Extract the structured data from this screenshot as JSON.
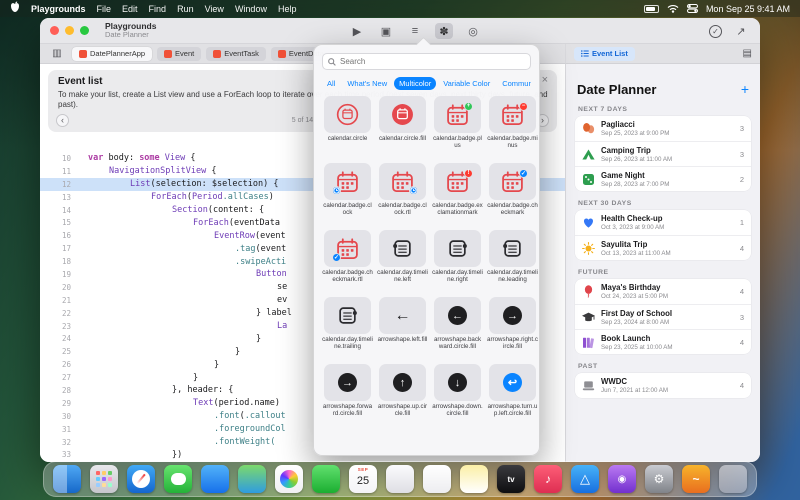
{
  "colors": {
    "accent": "#0A84FF",
    "symbol_red": "#E5484D",
    "selection": "#CDE1F9"
  },
  "menubar": {
    "app_name": "Playgrounds",
    "items": [
      "File",
      "Edit",
      "Find",
      "Run",
      "View",
      "Window",
      "Help"
    ],
    "clock": "Mon Sep 25 9:41 AM"
  },
  "titlebar": {
    "title": "Playgrounds",
    "subtitle": "Date Planner"
  },
  "toolbar": {
    "center": [
      {
        "name": "run",
        "glyph": "▶"
      },
      {
        "name": "live-preview",
        "glyph": "▣"
      },
      {
        "name": "inspector",
        "glyph": "≡"
      },
      {
        "name": "symbols-library",
        "glyph": "✽",
        "active": true
      },
      {
        "name": "device-settings",
        "glyph": "◎"
      }
    ],
    "right": [
      {
        "name": "status-done",
        "glyph": "✓",
        "circled": true
      },
      {
        "name": "enter-fullscreen",
        "glyph": "↗"
      }
    ]
  },
  "tabs": [
    {
      "label": "DatePlannerApp"
    },
    {
      "label": "Event"
    },
    {
      "label": "EventTask"
    },
    {
      "label": "EventData"
    }
  ],
  "lesson": {
    "title": "Event list",
    "body": "To make your list, create a List view and use a ForEach loop to iterate over each time period (next seven days, next thirty days, future, and past).",
    "page": "5 of 14"
  },
  "code": {
    "lines": [
      {
        "n": 10,
        "i": 0,
        "hl": false,
        "t": [
          [
            "var",
            "kw"
          ],
          [
            " body: ",
            "pl"
          ],
          [
            "some",
            "kw"
          ],
          [
            " ",
            "pl"
          ],
          [
            "View",
            "ty"
          ],
          [
            " {",
            "pl"
          ]
        ]
      },
      {
        "n": 11,
        "i": 1,
        "hl": false,
        "t": [
          [
            "NavigationSplitView",
            "ty"
          ],
          [
            " {",
            "pl"
          ]
        ]
      },
      {
        "n": 12,
        "i": 2,
        "hl": true,
        "t": [
          [
            "List",
            "ty"
          ],
          [
            "(selection: ",
            "pl"
          ],
          [
            "$selection",
            "pl"
          ],
          [
            ") {",
            "pl"
          ]
        ]
      },
      {
        "n": 13,
        "i": 3,
        "hl": false,
        "t": [
          [
            "ForEach",
            "ty"
          ],
          [
            "(",
            "pl"
          ],
          [
            "Period",
            "ty"
          ],
          [
            ".allCases",
            "me"
          ],
          [
            ") ",
            "pl"
          ]
        ]
      },
      {
        "n": 14,
        "i": 4,
        "hl": false,
        "t": [
          [
            "Section",
            "ty"
          ],
          [
            "(content: {",
            "pl"
          ]
        ]
      },
      {
        "n": 15,
        "i": 5,
        "hl": false,
        "t": [
          [
            "ForEach",
            "ty"
          ],
          [
            "(eventData",
            "pl"
          ]
        ]
      },
      {
        "n": 16,
        "i": 6,
        "hl": false,
        "t": [
          [
            "EventRow",
            "ty"
          ],
          [
            "(event",
            "pl"
          ]
        ]
      },
      {
        "n": 17,
        "i": 7,
        "hl": false,
        "t": [
          [
            ".tag",
            "me"
          ],
          [
            "(event",
            "pl"
          ]
        ]
      },
      {
        "n": 18,
        "i": 7,
        "hl": false,
        "t": [
          [
            ".swipeActi",
            "me"
          ]
        ]
      },
      {
        "n": 19,
        "i": 8,
        "hl": false,
        "t": [
          [
            "Button",
            "ty"
          ]
        ]
      },
      {
        "n": 20,
        "i": 9,
        "hl": false,
        "t": [
          [
            "se",
            "pl"
          ]
        ]
      },
      {
        "n": 21,
        "i": 9,
        "hl": false,
        "t": [
          [
            "ev",
            "pl"
          ]
        ]
      },
      {
        "n": 22,
        "i": 8,
        "hl": false,
        "t": [
          [
            "} label",
            "pl"
          ]
        ]
      },
      {
        "n": 23,
        "i": 9,
        "hl": false,
        "t": [
          [
            "La",
            "ty"
          ]
        ]
      },
      {
        "n": 24,
        "i": 8,
        "hl": false,
        "t": [
          [
            "}",
            "pl"
          ]
        ]
      },
      {
        "n": 25,
        "i": 7,
        "hl": false,
        "t": [
          [
            "}",
            "pl"
          ]
        ]
      },
      {
        "n": 26,
        "i": 6,
        "hl": false,
        "t": [
          [
            "}",
            "pl"
          ]
        ]
      },
      {
        "n": 27,
        "i": 5,
        "hl": false,
        "t": [
          [
            "}",
            "pl"
          ]
        ]
      },
      {
        "n": 28,
        "i": 4,
        "hl": false,
        "t": [
          [
            "}, header: {",
            "pl"
          ]
        ]
      },
      {
        "n": 29,
        "i": 5,
        "hl": false,
        "t": [
          [
            "Text",
            "ty"
          ],
          [
            "(period.name)",
            "pl"
          ]
        ]
      },
      {
        "n": 30,
        "i": 6,
        "hl": false,
        "t": [
          [
            ".font",
            "me"
          ],
          [
            "(",
            "pl"
          ],
          [
            ".callout",
            "me"
          ]
        ]
      },
      {
        "n": 31,
        "i": 6,
        "hl": false,
        "t": [
          [
            ".foregroundCol",
            "me"
          ]
        ]
      },
      {
        "n": 32,
        "i": 6,
        "hl": false,
        "t": [
          [
            ".fontWeight(",
            "me"
          ]
        ]
      },
      {
        "n": 33,
        "i": 4,
        "hl": false,
        "t": [
          [
            "})",
            "pl"
          ]
        ]
      }
    ]
  },
  "symbols": {
    "placeholder": "Search",
    "categories": [
      {
        "label": "All",
        "selected": false
      },
      {
        "label": "What's New",
        "selected": false
      },
      {
        "label": "Multicolor",
        "selected": true
      },
      {
        "label": "Variable Color",
        "selected": false
      },
      {
        "label": "Communication",
        "selected": false
      }
    ],
    "items": [
      {
        "label": "calendar.circle",
        "k": "cc"
      },
      {
        "label": "calendar.circle.fill",
        "k": "ccf"
      },
      {
        "label": "calendar.badge.plus",
        "k": "cal",
        "badge": "+",
        "bc": "#31C759",
        "bp": "tr"
      },
      {
        "label": "calendar.badge.minus",
        "k": "cal",
        "badge": "−",
        "bc": "#FF3B30",
        "bp": "tr"
      },
      {
        "label": "calendar.badge.clock",
        "k": "cal",
        "badge": "clock",
        "bc": "#0A84FF",
        "bp": "bl"
      },
      {
        "label": "calendar.badge.clock.rtl",
        "k": "cal",
        "badge": "clock",
        "bc": "#0A84FF",
        "bp": "br"
      },
      {
        "label": "calendar.badge.exclamationmark",
        "k": "cal",
        "badge": "!",
        "bc": "#FF3B30",
        "bp": "tr"
      },
      {
        "label": "calendar.badge.checkmark",
        "k": "cal",
        "badge": "✓",
        "bc": "#0A84FF",
        "bp": "tr"
      },
      {
        "label": "calendar.badge.checkmark.rtl",
        "k": "cal",
        "badge": "✓",
        "bc": "#0A84FF",
        "bp": "bl"
      },
      {
        "label": "calendar.day.timeline.left",
        "k": "tl",
        "side": "left"
      },
      {
        "label": "calendar.day.timeline.right",
        "k": "tl",
        "side": "right"
      },
      {
        "label": "calendar.day.timeline.leading",
        "k": "tl",
        "side": "left"
      },
      {
        "label": "calendar.day.timeline.trailing",
        "k": "tl",
        "side": "right"
      },
      {
        "label": "arrowshape.left.fill",
        "k": "af",
        "dir": "left"
      },
      {
        "label": "arrowshape.backward.circle.fill",
        "k": "ac",
        "dir": "left"
      },
      {
        "label": "arrowshape.right.circle.fill",
        "k": "ac",
        "dir": "right"
      },
      {
        "label": "arrowshape.forward.circle.fill",
        "k": "ac",
        "dir": "right"
      },
      {
        "label": "arrowshape.up.circle.fill",
        "k": "ac",
        "dir": "up"
      },
      {
        "label": "arrowshape.down.circle.fill",
        "k": "ac",
        "dir": "down"
      },
      {
        "label": "arrowshape.turn.up.left.circle.fill",
        "k": "ac",
        "dir": "turn",
        "color": "#0A84FF"
      }
    ]
  },
  "preview": {
    "tab": "Event List",
    "title": "Date Planner",
    "sections": [
      {
        "header": "NEXT 7 DAYS",
        "items": [
          {
            "name": "Pagliacci",
            "date": "Sep 25, 2023 at 9:00 PM",
            "count": 3,
            "icon": "masks",
            "color": "#E0642F"
          },
          {
            "name": "Camping Trip",
            "date": "Sep 26, 2023 at 11:00 AM",
            "count": 3,
            "icon": "tent",
            "color": "#2E9E4F"
          },
          {
            "name": "Game Night",
            "date": "Sep 28, 2023 at 7:00 PM",
            "count": 2,
            "icon": "dice",
            "color": "#2E9E4F"
          }
        ]
      },
      {
        "header": "NEXT 30 DAYS",
        "items": [
          {
            "name": "Health Check-up",
            "date": "Oct 3, 2023 at 9:00 AM",
            "count": 1,
            "icon": "heart",
            "color": "#3478F6"
          },
          {
            "name": "Sayulita Trip",
            "date": "Oct 13, 2023 at 11:00 AM",
            "count": 4,
            "icon": "sun",
            "color": "#F5B01B"
          }
        ]
      },
      {
        "header": "FUTURE",
        "items": [
          {
            "name": "Maya's Birthday",
            "date": "Oct 24, 2023 at 5:00 PM",
            "count": 4,
            "icon": "balloon",
            "color": "#E0454B"
          },
          {
            "name": "First Day of School",
            "date": "Sep 23, 2024 at 8:00 AM",
            "count": 3,
            "icon": "gradcap",
            "color": "#3A3A3C"
          },
          {
            "name": "Book Launch",
            "date": "Sep 23, 2025 at 10:00 AM",
            "count": 4,
            "icon": "books",
            "color": "#8E4FD1"
          }
        ]
      },
      {
        "header": "PAST",
        "items": [
          {
            "name": "WWDC",
            "date": "Jun 7, 2021 at 12:00 AM",
            "count": 4,
            "icon": "laptop",
            "color": "#8E8E93"
          }
        ]
      }
    ]
  },
  "dock": {
    "items": [
      {
        "name": "finder",
        "c1": "#4FA8F4",
        "c2": "#1668C9"
      },
      {
        "name": "launchpad",
        "c1": "#E8E8EC",
        "c2": "#C6C6CC"
      },
      {
        "name": "safari",
        "c1": "#41A9F6",
        "c2": "#1566CE"
      },
      {
        "name": "messages",
        "c1": "#67E46F",
        "c2": "#24B238"
      },
      {
        "name": "mail",
        "c1": "#52B2F9",
        "c2": "#1670EA"
      },
      {
        "name": "maps",
        "c1": "#7CD96B",
        "c2": "#2F9CE0"
      },
      {
        "name": "photos",
        "c1": "#FFFFFF",
        "c2": "#EFEFF2"
      },
      {
        "name": "facetime",
        "c1": "#61E06E",
        "c2": "#1BAE31"
      },
      {
        "name": "calendar",
        "c1": "#FFFFFF",
        "c2": "#F4F4F6"
      },
      {
        "name": "contacts",
        "c1": "#FBFBFD",
        "c2": "#DFDFE4"
      },
      {
        "name": "reminders",
        "c1": "#FFFFFF",
        "c2": "#EDEDF0"
      },
      {
        "name": "notes",
        "c1": "#FBEFA6",
        "c2": "#FFFFFF"
      },
      {
        "name": "tv",
        "c1": "#3A3A3E",
        "c2": "#0E0E10"
      },
      {
        "name": "music",
        "c1": "#FD5E77",
        "c2": "#DE2E52"
      },
      {
        "name": "appstore",
        "c1": "#47B2F8",
        "c2": "#186FE0"
      },
      {
        "name": "podcasts",
        "c1": "#BA79F2",
        "c2": "#7230CE"
      },
      {
        "name": "settings",
        "c1": "#C9CBD1",
        "c2": "#808389"
      },
      {
        "name": "playgrounds",
        "c1": "#F7B32B",
        "c2": "#E96E1F"
      },
      {
        "name": "trash",
        "c1": "rgba(240,240,245,0.55)",
        "c2": "rgba(190,190,200,0.5)"
      }
    ]
  }
}
